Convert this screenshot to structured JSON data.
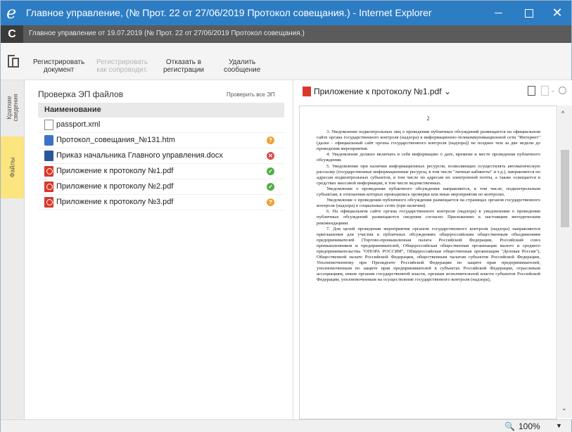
{
  "window": {
    "title": "Главное управление, (№ Прот. 22 от 27/06/2019 Протокол совещания.) - Internet Explorer",
    "logo": "e",
    "minimize_icon": "minimize-icon",
    "maximize_icon": "maximize-icon",
    "close_glyph": "✕",
    "title_bar_color": "#2d7dc4"
  },
  "app": {
    "logo": "C",
    "title": "Главное управление от 19.07.2019 (№ Прот. 22 от 27/06/2019 Протокол совещания.)"
  },
  "toolbar": {
    "buttons": [
      {
        "line1": "Регистрировать",
        "line2": "документ",
        "enabled": true
      },
      {
        "line1": "Регистрировать",
        "line2": "как сопроводит.",
        "enabled": false
      },
      {
        "line1": "Отказать в",
        "line2": "регистрации",
        "enabled": true
      },
      {
        "line1": "Удалить",
        "line2": "сообщение",
        "enabled": true
      }
    ]
  },
  "sidebar_tabs": [
    {
      "line1": "Краткие",
      "line2": "сведения",
      "active": false
    },
    {
      "label": "Файлы",
      "active": true
    }
  ],
  "files_panel": {
    "title": "Проверка ЭП файлов",
    "check_all": "Проверить все ЭП",
    "column_header": "Наименование",
    "files": [
      {
        "name": "passport.xml",
        "icon": "xml-file-icon",
        "status": null
      },
      {
        "name": "Протокол_совещания_№131.htm",
        "icon": "htm-file-icon",
        "status": "warning"
      },
      {
        "name": "Приказ начальника Главного управления.docx",
        "icon": "docx-file-icon",
        "status": "error"
      },
      {
        "name": "Приложение к протоколу №1.pdf",
        "icon": "pdf-file-icon",
        "status": "ok"
      },
      {
        "name": "Приложение к протоколу №2.pdf",
        "icon": "pdf-file-icon",
        "status": "ok"
      },
      {
        "name": "Приложение к протоколу №3.pdf",
        "icon": "pdf-file-icon",
        "status": "warning"
      }
    ],
    "status_glyphs": {
      "warning": "?",
      "error": "✕",
      "ok": "✓"
    },
    "status_colors": {
      "warning": "#f0a030",
      "error": "#e04848",
      "ok": "#4fae48"
    }
  },
  "viewer": {
    "file_title": "Приложение к протоколу №1.pdf",
    "dropdown_glyph": "⌄",
    "page_number": "2",
    "paragraphs": [
      "3. Уведомление подконтрольных лиц о проведении публичных обсуждений размещается на официальном сайте органа государственного контроля (надзора) в информационно-телекоммуникационной сети \"Интернет\" (далее - официальный сайт органа государственного контроля (надзора)) не позднее чем за две недели до проведения мероприятия.",
      "4. Уведомление должно включать в себя информацию о дате, времени и месте проведения публичного обсуждения.",
      "5. Уведомление при наличии информационных ресурсов, позволяющих осуществлять автоматическую рассылку (государственные информационные ресурсы, в том числе \"личные кабинеты\" и т.д.), направляется по адресам подконтрольных субъектов, в том числе по адресам их электронной почты, а также освещается в средствах массовой информации, в том числе ведомственных.",
      "Уведомление о проведении публичного обсуждения направляется, в том числе, подконтрольным субъектам, в отношении которых проводились проверки или иные мероприятия по контролю.",
      "Уведомление о проведении публичного обсуждения размещается на страницах органов государственного контроля (надзора) в социальных сетях (при наличии).",
      "6. На официальном сайте органа государственного контроля (надзора) в уведомлении о проведении публичных обсуждений размещаются сведения согласно Приложению к настоящим методическим рекомендациям.",
      "7. Для целей проведения мероприятия органом государственного контроля (надзора) направляются приглашения для участия в публичных обсуждениях общероссийским общественным объединениям предпринимателей (Торгово-промышленная палата Российской Федерации, Российский союз промышленников и предпринимателей, Общероссийская общественная организация малого и среднего предпринимательства \"ОПОРА РОССИИ\", Общероссийская общественная организация \"Деловая Россия\"), Общественной палате Российской Федерации, общественным палатам субъектов Российской Федерации, Уполномоченному при Президенте Российской Федерации по защите прав предпринимателей, уполномоченным по защите прав предпринимателей в субъектах Российской Федерации, отраслевым ассоциациям, иным органам государственной власти, органам исполнительной власти субъектов Российской Федерации, уполномоченным на осуществление государственного контроля (надзора),"
    ]
  },
  "statusbar": {
    "zoom": "100%",
    "zoom_dropdown": "▼"
  }
}
